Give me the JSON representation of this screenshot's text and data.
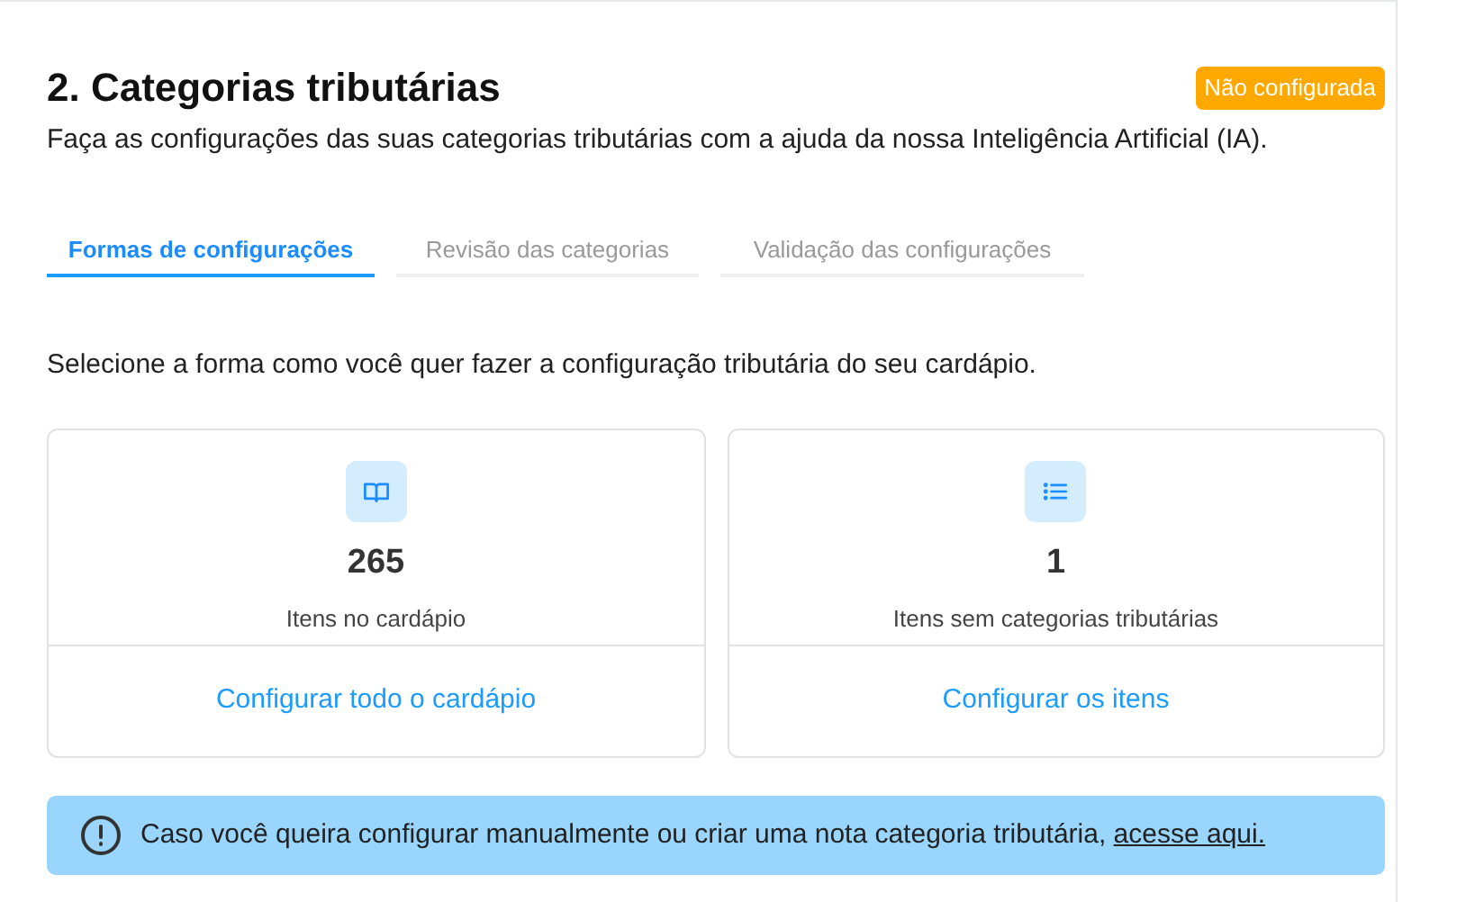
{
  "section": {
    "title": "2. Categorias tributárias",
    "status_badge": "Não configurada",
    "description": "Faça as configurações das suas categorias tributárias com a ajuda da nossa Inteligência Artificial (IA)."
  },
  "tabs": [
    {
      "label": "Formas de configurações",
      "selected": true
    },
    {
      "label": "Revisão das categorias",
      "selected": false
    },
    {
      "label": "Validação das configurações",
      "selected": false
    }
  ],
  "instruction": "Selecione a forma como você quer fazer a configuração tributária do seu cardápio.",
  "cards": [
    {
      "kind": "book",
      "count": "265",
      "label": "Itens no cardápio",
      "action": "Configurar todo o cardápio"
    },
    {
      "kind": "list",
      "count": "1",
      "label": "Itens sem categorias tributárias",
      "action": "Configurar os itens"
    }
  ],
  "alert": {
    "message": "Caso você queira configurar manualmente ou criar uma nota categoria tributária,",
    "link": "acesse aqui."
  }
}
